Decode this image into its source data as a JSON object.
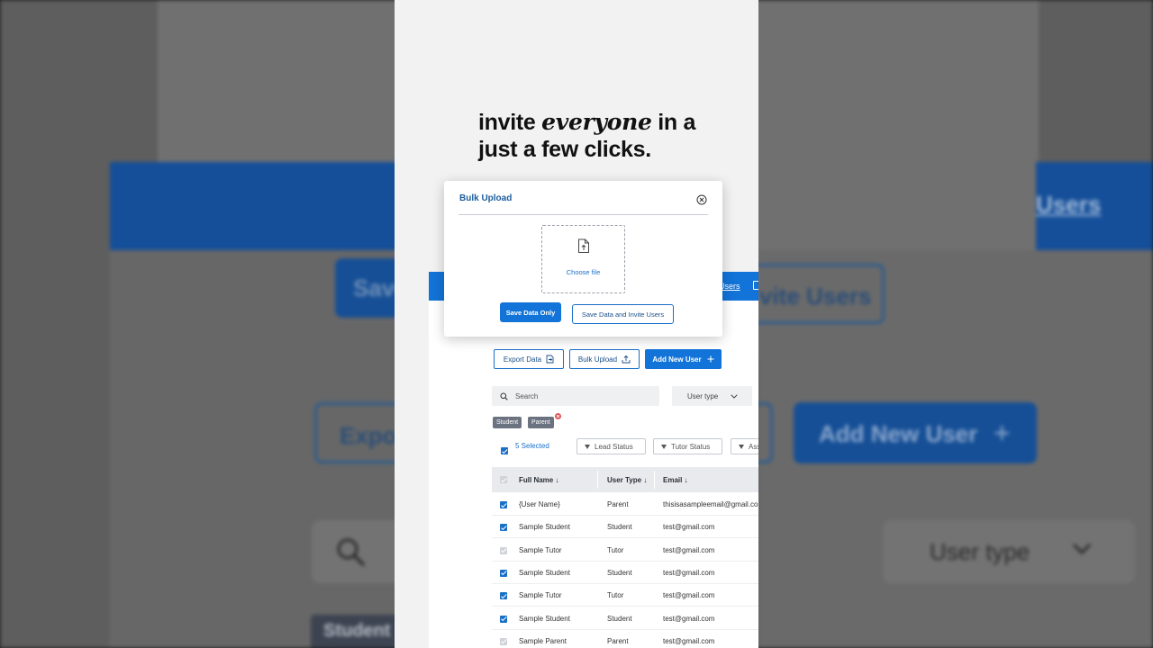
{
  "headline": {
    "part1": "invite ",
    "emphasis": "everyone",
    "part2": " in a",
    "line2": "just a few clicks."
  },
  "background_zoom": {
    "save_partial": "Save",
    "invite_partial": "vite Users",
    "users_partial": "Users",
    "export_partial": "Expor",
    "add_new_user": "Add New User",
    "user_type": "User type",
    "student_partial": "Student"
  },
  "nav": {
    "users_label": "Users"
  },
  "toolbar": {
    "export_label": "Export Data",
    "bulk_upload_label": "Bulk Upload",
    "add_user_label": "Add New User"
  },
  "search": {
    "placeholder": "Search"
  },
  "user_type_filter": {
    "label": "User type"
  },
  "tags": [
    "Student",
    "Parent"
  ],
  "selection": {
    "count_label": "5 Selected"
  },
  "filters": [
    "Lead Status",
    "Tutor Status",
    "Ass"
  ],
  "table": {
    "columns": [
      "Full Name",
      "User Type",
      "Email"
    ],
    "rows": [
      {
        "name": "{User Name}",
        "type": "Parent",
        "email": "thisisasampleemail@gmail.com",
        "checked": true
      },
      {
        "name": "Sample Student",
        "type": "Student",
        "email": "test@gmail.com",
        "checked": true
      },
      {
        "name": "Sample Tutor",
        "type": "Tutor",
        "email": "test@gmail.com",
        "checked": false
      },
      {
        "name": "Sample Student",
        "type": "Student",
        "email": "test@gmail.com",
        "checked": true
      },
      {
        "name": "Sample Tutor",
        "type": "Tutor",
        "email": "test@gmail.com",
        "checked": true
      },
      {
        "name": "Sample Student",
        "type": "Student",
        "email": "test@gmail.com",
        "checked": true
      },
      {
        "name": "Sample Parent",
        "type": "Parent",
        "email": "test@gmail.com",
        "checked": false
      }
    ]
  },
  "modal": {
    "title": "Bulk Upload",
    "dropzone_label": "Choose file",
    "save_only_label": "Save Data Only",
    "save_invite_label": "Save Data and Invite Users"
  },
  "colors": {
    "primary": "#1273d8",
    "title_blue": "#1b5c9c",
    "tag_gray": "#6b7280",
    "remove_red": "#e05656"
  }
}
